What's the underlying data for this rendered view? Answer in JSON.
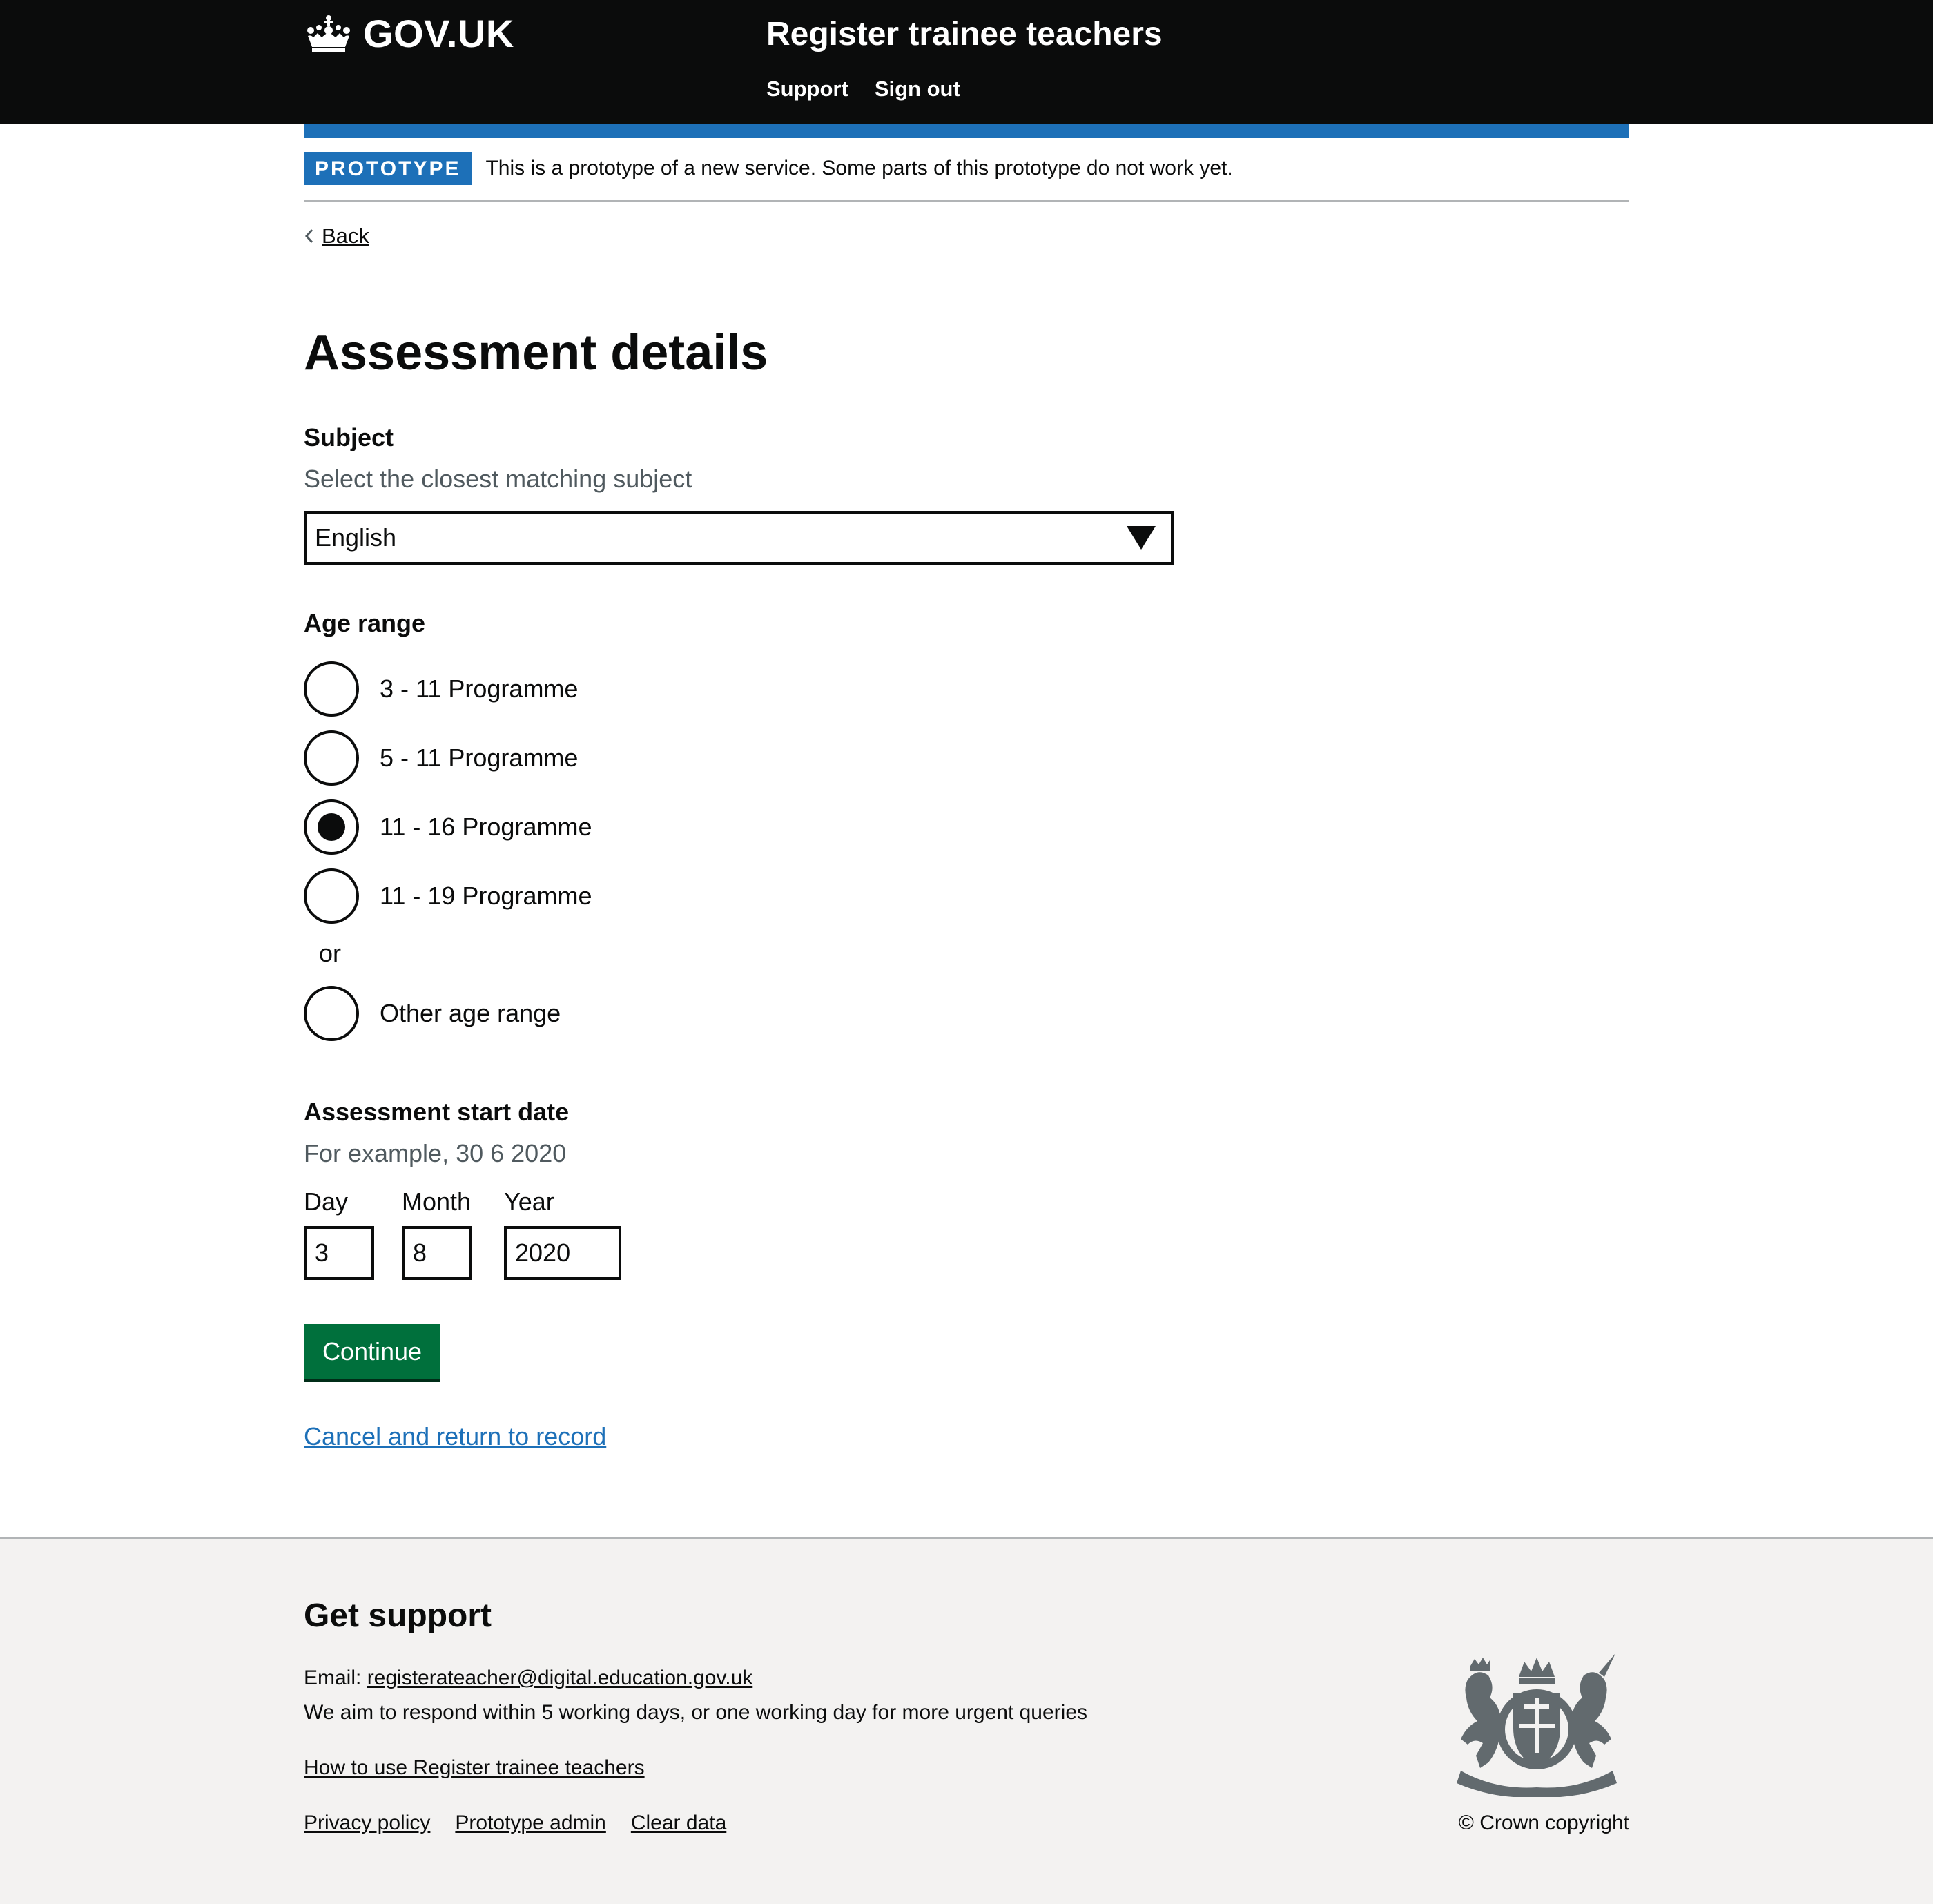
{
  "header": {
    "logo_text": "GOV.UK",
    "service_name": "Register trainee teachers",
    "nav": [
      {
        "label": "Support"
      },
      {
        "label": "Sign out"
      }
    ]
  },
  "phase_banner": {
    "tag": "PROTOTYPE",
    "text": "This is a prototype of a new service. Some parts of this prototype do not work yet."
  },
  "back_link": "Back",
  "page_title": "Assessment details",
  "subject": {
    "label": "Subject",
    "hint": "Select the closest matching subject",
    "selected": "English"
  },
  "age_range": {
    "label": "Age range",
    "options": [
      {
        "label": "3 - 11 Programme",
        "checked": false
      },
      {
        "label": "5 - 11 Programme",
        "checked": false
      },
      {
        "label": "11 - 16 Programme",
        "checked": true
      },
      {
        "label": "11 - 19 Programme",
        "checked": false
      }
    ],
    "divider": "or",
    "other": {
      "label": "Other age range",
      "checked": false
    }
  },
  "start_date": {
    "label": "Assessment start date",
    "hint": "For example, 30 6 2020",
    "day": {
      "label": "Day",
      "value": "3"
    },
    "month": {
      "label": "Month",
      "value": "8"
    },
    "year": {
      "label": "Year",
      "value": "2020"
    }
  },
  "continue_label": "Continue",
  "cancel_label": "Cancel and return to record",
  "footer": {
    "title": "Get support",
    "email_prefix": "Email: ",
    "email": "registerateacher@digital.education.gov.uk",
    "respond_text": "We aim to respond within 5 working days, or one working day for more urgent queries",
    "howto_link": "How to use Register trainee teachers",
    "links": [
      {
        "label": "Privacy policy"
      },
      {
        "label": "Prototype admin"
      },
      {
        "label": "Clear data"
      }
    ],
    "copyright": "© Crown copyright"
  },
  "colors": {
    "header_bg": "#0b0c0c",
    "brand_blue": "#1d70b8",
    "button_green": "#00703c",
    "footer_bg": "#f3f2f1"
  }
}
